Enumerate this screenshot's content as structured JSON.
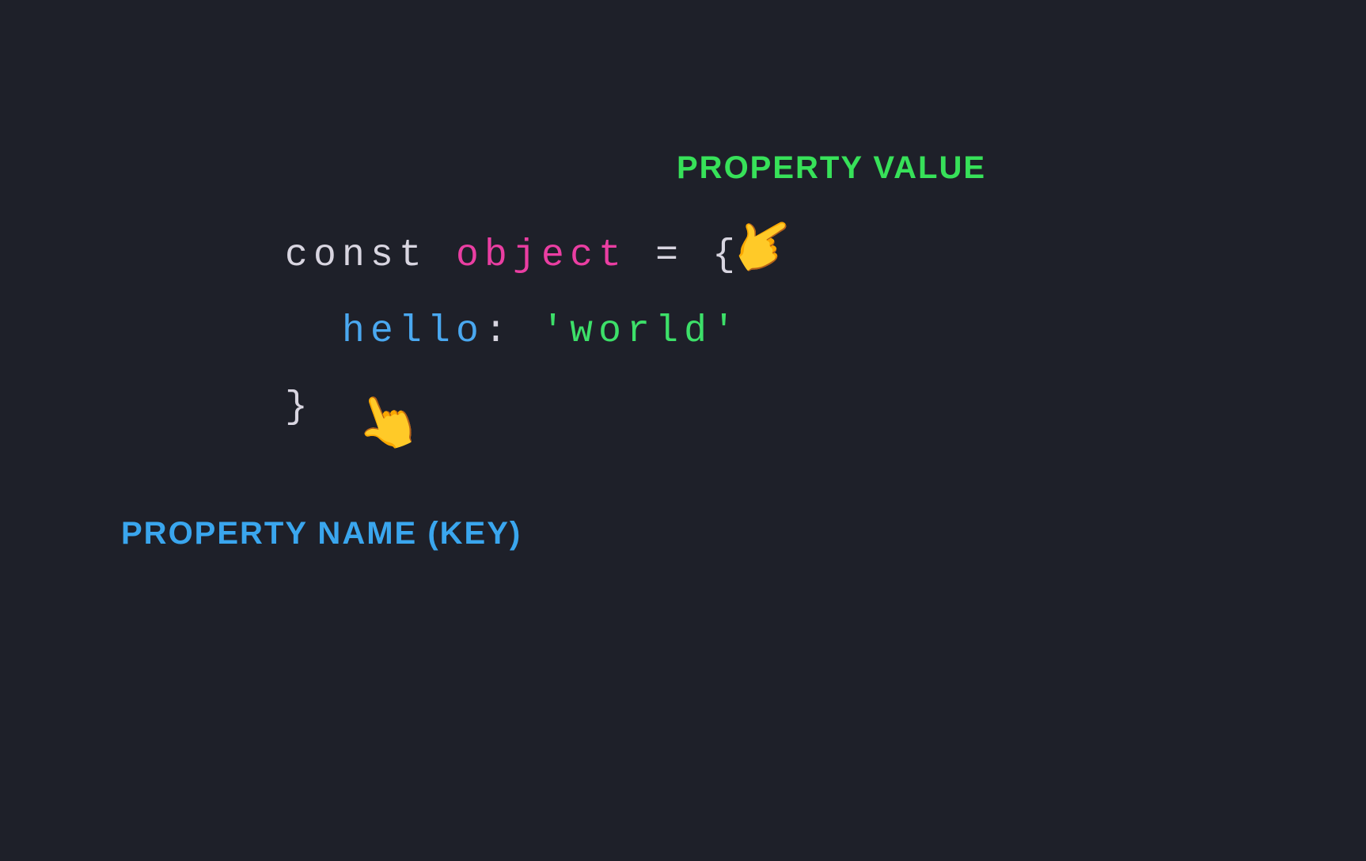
{
  "code": {
    "keyword_const": "const",
    "identifier": "object",
    "equals": "=",
    "brace_open": "{",
    "property_key": "hello",
    "colon": ":",
    "property_value": "'world'",
    "brace_close": "}",
    "indent": "  "
  },
  "labels": {
    "property_value": "Property Value",
    "property_name": "Property Name (Key)"
  },
  "colors": {
    "background": "#1e2029",
    "keyword_punct": "#d8d5e0",
    "object": "#ea3ea2",
    "key": "#4aa8f0",
    "string": "#3de069",
    "label_value": "#37e159",
    "label_key": "#3aa6ee"
  },
  "emoji": {
    "pointing_down_left": "👆",
    "pointing_up": "👆"
  }
}
